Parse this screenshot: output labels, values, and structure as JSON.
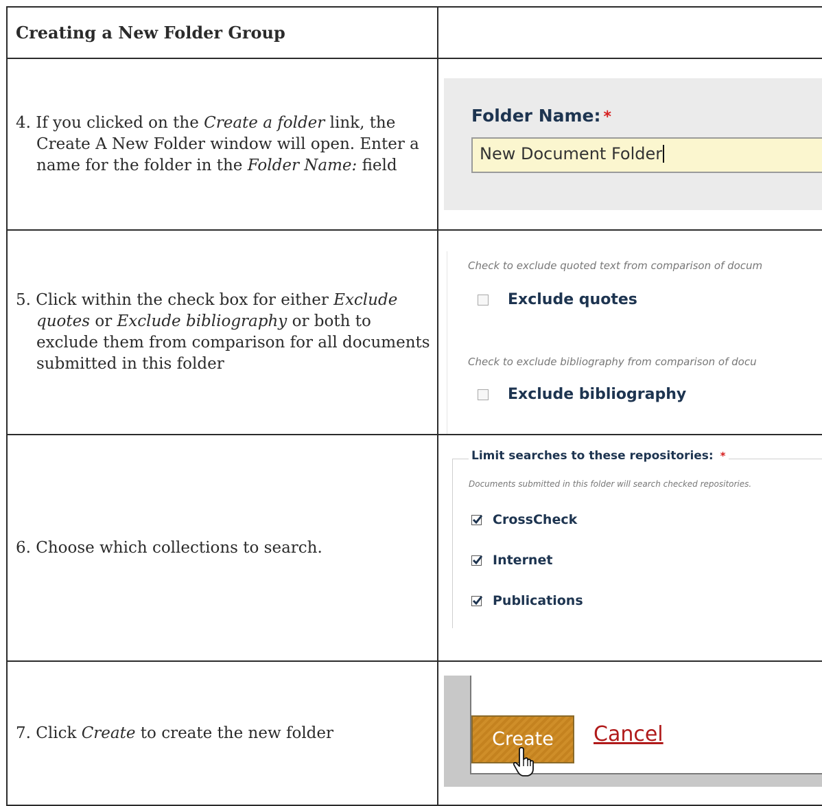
{
  "header": {
    "title": "Creating a New Folder Group"
  },
  "steps": {
    "step4": {
      "t1": "4. If you clicked on the ",
      "t2": "Create a folder",
      "t3": " link, the Create A New Folder window will open. Enter a name for the folder in the ",
      "t4": "Folder Name:",
      "t5": " field",
      "shot": {
        "label": "Folder Name:",
        "required": "*",
        "value": "New Document Folder"
      }
    },
    "step5": {
      "t1": "5. Click within the check box for either ",
      "t2": "Exclude quotes",
      "t3": " or ",
      "t4": "Exclude bibliography",
      "t5": " or both to exclude them from comparison for all documents submitted in this folder",
      "shot": {
        "hint_quotes": "Check to exclude quoted text from comparison of docum",
        "label_quotes": "Exclude quotes",
        "hint_bib": "Check to exclude bibliography from comparison of docu",
        "label_bib": "Exclude bibliography"
      }
    },
    "step6": {
      "text": "6. Choose which collections to search.",
      "shot": {
        "legend": "Limit searches to these repositories:",
        "required": "*",
        "hint": "Documents submitted in this folder will search checked repositories.",
        "repos": [
          "CrossCheck",
          "Internet",
          "Publications"
        ]
      }
    },
    "step7": {
      "t1": "7. Click ",
      "t2": "Create",
      "t3": " to create the new folder",
      "shot": {
        "create_label": "Create",
        "cancel_label": "Cancel"
      }
    }
  },
  "colors": {
    "accent_navy": "#1d3450",
    "required_red": "#d61f1f",
    "create_orange": "#c4821f",
    "cancel_red": "#b01a1a",
    "input_yellow": "#fbf6cf"
  },
  "icons": [
    "checkbox-checked-icon",
    "checkbox-empty-icon",
    "hand-pointer-icon"
  ]
}
